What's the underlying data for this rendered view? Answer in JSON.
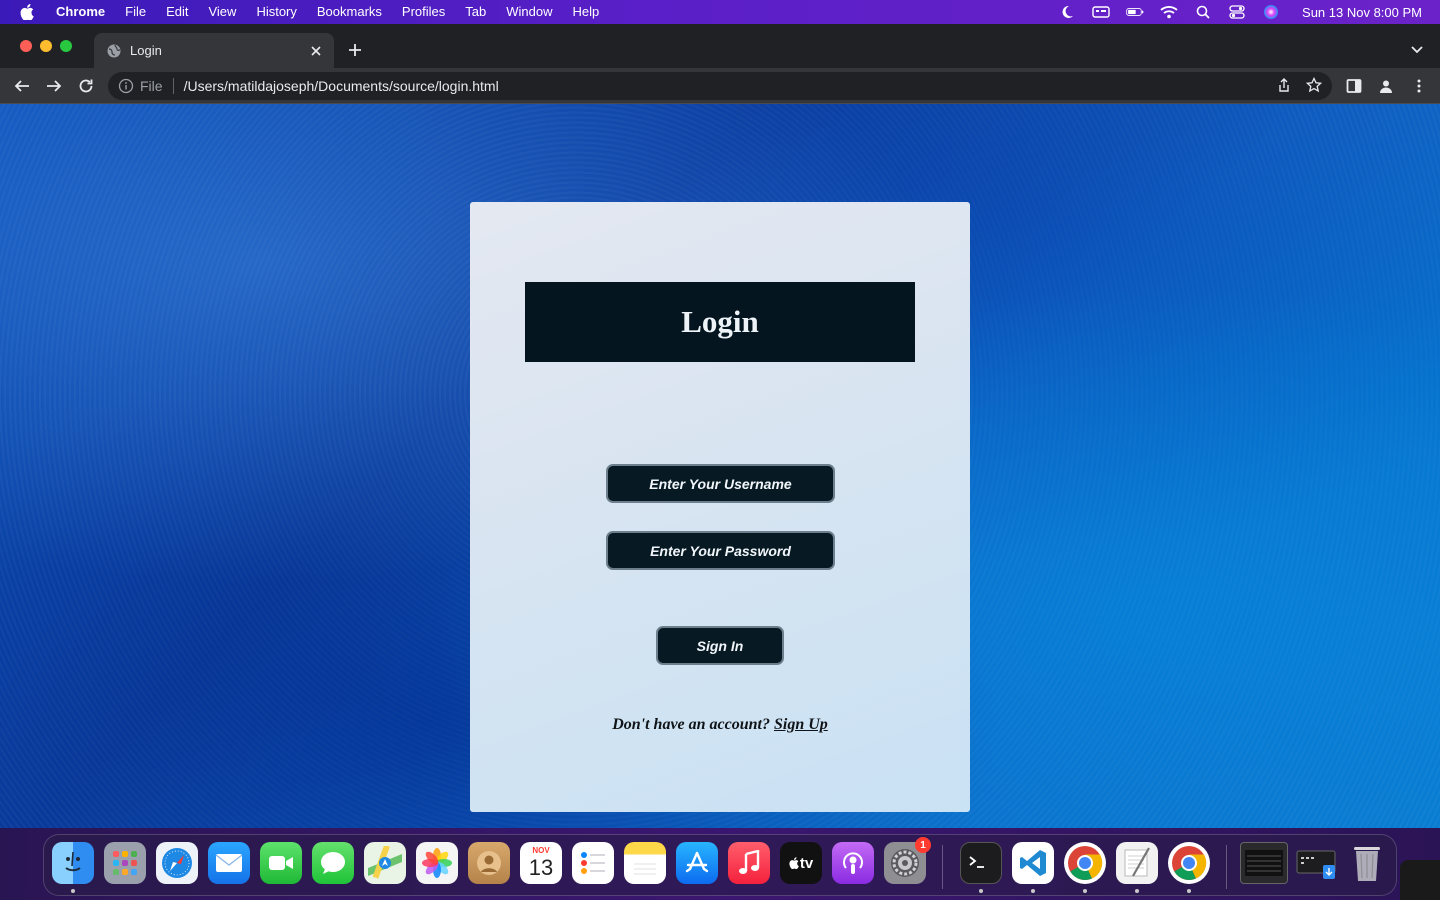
{
  "menubar": {
    "app_name": "Chrome",
    "items": [
      "File",
      "Edit",
      "View",
      "History",
      "Bookmarks",
      "Profiles",
      "Tab",
      "Window",
      "Help"
    ],
    "clock": "Sun 13 Nov  8:00 PM"
  },
  "browser": {
    "tab_title": "Login",
    "url_scheme": "File",
    "url_path": "/Users/matildajoseph/Documents/source/login.html"
  },
  "page": {
    "title": "Login",
    "username_placeholder": "Enter Your Username",
    "password_placeholder": "Enter Your Password",
    "signin_label": "Sign In",
    "signup_prompt": "Don't have an account?",
    "signup_link": "Sign Up"
  },
  "dock": {
    "calendar_month": "NOV",
    "calendar_day": "13",
    "tv_label": "tv",
    "settings_badge": "1",
    "colors": {
      "finder": "#2f9bff",
      "safari": "#1e88e5",
      "mail": "#1c8cf5",
      "facetime": "#2ecc40",
      "messages": "#30d158",
      "photos": "#f0f0f0",
      "contacts": "#c89a5a",
      "notes": "#ffd84a",
      "appstore": "#1a8cff",
      "music": "#fb3b4e",
      "podcasts": "#9b46e4",
      "vscode": "#1f8ad2"
    }
  }
}
